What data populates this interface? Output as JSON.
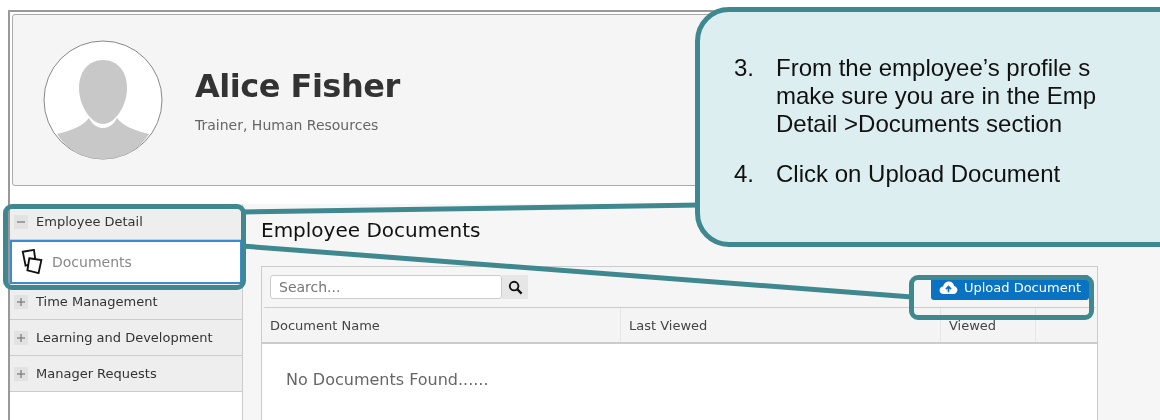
{
  "profile": {
    "name": "Alice Fisher",
    "subtitle": "Trainer, Human Resources"
  },
  "sidebar": {
    "items": [
      {
        "label": "Employee Detail",
        "expanded": true,
        "children": [
          {
            "label": "Documents",
            "selected": true
          }
        ]
      },
      {
        "label": "Time Management",
        "expanded": false
      },
      {
        "label": "Learning and Development",
        "expanded": false
      },
      {
        "label": "Manager Requests",
        "expanded": false
      }
    ]
  },
  "main": {
    "title": "Employee Documents",
    "search": {
      "placeholder": "Search..."
    },
    "upload_button": "Upload Document",
    "table": {
      "columns": [
        "Document Name",
        "Last Viewed",
        "Viewed"
      ],
      "empty_message": "No Documents Found......"
    }
  },
  "callout": {
    "steps": [
      {
        "number": "3.",
        "lines": [
          "From the employee’s profile s",
          "make sure you are in the Emp",
          "Detail >Documents section"
        ]
      },
      {
        "number": "4.",
        "lines": [
          "Click on Upload Document"
        ]
      }
    ]
  }
}
